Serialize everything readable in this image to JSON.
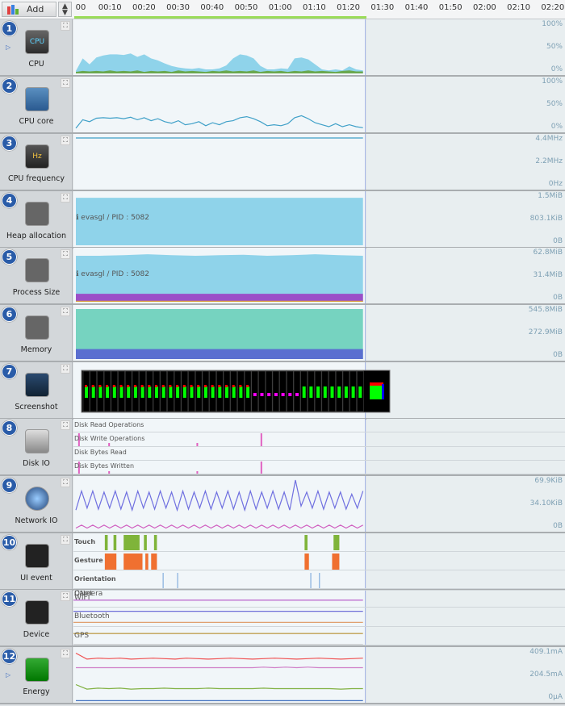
{
  "toolbar": {
    "add_label": "Add",
    "sort_icon": "up-down-arrows-icon",
    "add_icon": "bar-chart-icon"
  },
  "timeline": {
    "ticks": [
      "00",
      "00:10",
      "00:20",
      "00:30",
      "00:40",
      "00:50",
      "01:00",
      "01:10",
      "01:20",
      "01:30",
      "01:40",
      "01:50",
      "02:00",
      "02:10",
      "02:20"
    ],
    "recorded_seconds": 85
  },
  "rows": [
    {
      "num": "1",
      "label": "CPU",
      "icon": "cpu-chip-icon",
      "icon_text": "CPU",
      "axis": [
        "100%",
        "50%",
        "0%"
      ]
    },
    {
      "num": "2",
      "label": "CPU core",
      "icon": "cpu-core-icon",
      "axis": [
        "100%",
        "50%",
        "0%"
      ]
    },
    {
      "num": "3",
      "label": "CPU frequency",
      "icon": "hz-icon",
      "icon_text": "Hz",
      "axis": [
        "4.4MHz",
        "2.2MHz",
        "0Hz"
      ]
    },
    {
      "num": "4",
      "label": "Heap allocation",
      "icon": "memory-chip-icon",
      "axis": [
        "1.5MiB",
        "803.1KiB",
        "0B"
      ],
      "pid": "evasgl / PID : 5082"
    },
    {
      "num": "5",
      "label": "Process Size",
      "icon": "process-icon",
      "axis": [
        "62.8MiB",
        "31.4MiB",
        "0B"
      ],
      "pid": "evasgl / PID : 5082"
    },
    {
      "num": "6",
      "label": "Memory",
      "icon": "memory-icon",
      "axis": [
        "545.8MiB",
        "272.9MiB",
        "0B"
      ]
    },
    {
      "num": "7",
      "label": "Screenshot",
      "icon": "camera-icon"
    },
    {
      "num": "8",
      "label": "Disk IO",
      "icon": "hard-disk-icon",
      "subs": [
        "Disk Read Operations",
        "Disk Write Operations",
        "Disk Bytes Read",
        "Disk Bytes Written"
      ]
    },
    {
      "num": "9",
      "label": "Network IO",
      "icon": "network-icon",
      "axis": [
        "69.9KiB",
        "34.10KiB",
        "0B"
      ]
    },
    {
      "num": "10",
      "label": "UI event",
      "icon": "touch-phone-icon",
      "subs": [
        "Touch",
        "Gesture",
        "Orientation"
      ]
    },
    {
      "num": "11",
      "label": "Device",
      "icon": "device-icon",
      "subs": [
        "WIFI",
        "Bluetooth",
        "GPS",
        "DNet",
        "Camera"
      ]
    },
    {
      "num": "12",
      "label": "Energy",
      "icon": "battery-icon",
      "axis": [
        "409.1mA",
        "204.5mA",
        "0µA"
      ]
    }
  ],
  "series": {
    "cpu_total": [
      5,
      30,
      18,
      32,
      36,
      38,
      38,
      37,
      40,
      33,
      38,
      30,
      26,
      20,
      15,
      12,
      10,
      9,
      11,
      8,
      8,
      10,
      16,
      30,
      38,
      36,
      30,
      15,
      8,
      8,
      10,
      9,
      30,
      32,
      28,
      18,
      8,
      6,
      8,
      6,
      14,
      8,
      6
    ],
    "cpu_app": [
      3,
      5,
      4,
      5,
      4,
      6,
      4,
      5,
      4,
      6,
      3,
      5,
      4,
      5,
      3,
      6,
      4,
      5,
      4,
      3,
      5,
      4,
      6,
      4,
      5,
      4,
      6,
      3,
      5,
      4,
      5,
      3,
      5,
      4,
      6,
      4,
      5,
      4,
      3,
      5,
      6,
      4,
      4
    ],
    "cpu_core": [
      5,
      22,
      18,
      25,
      26,
      25,
      26,
      24,
      27,
      22,
      26,
      20,
      24,
      18,
      15,
      20,
      12,
      14,
      18,
      10,
      16,
      12,
      18,
      20,
      26,
      28,
      24,
      18,
      10,
      12,
      10,
      14,
      26,
      30,
      24,
      16,
      12,
      8,
      14,
      8,
      12,
      8,
      6
    ],
    "cpu_freq": [
      100
    ],
    "heap": [
      95
    ],
    "process": {
      "total": [
        92,
        92,
        93,
        95,
        93,
        92,
        93,
        94,
        92,
        93,
        95,
        93,
        92
      ],
      "rss": [
        16
      ],
      "shared": [
        2
      ]
    },
    "memory": {
      "total": [
        100
      ],
      "used": [
        20
      ]
    },
    "disk_write_ops": [
      [
        2,
        100
      ],
      [
        28,
        25
      ],
      [
        64,
        25
      ],
      [
        98,
        100
      ]
    ],
    "disk_bytes_written": [
      [
        2,
        100
      ],
      [
        28,
        25
      ],
      [
        64,
        25
      ],
      [
        98,
        100
      ]
    ],
    "network_rx": [
      40,
      78,
      44,
      78,
      42,
      76,
      44,
      78,
      42,
      76,
      40,
      78,
      44,
      76,
      42,
      78,
      44,
      76,
      40,
      78,
      42,
      76,
      44,
      78,
      42,
      76,
      44,
      78,
      42,
      76,
      40,
      78,
      42,
      76,
      44,
      78,
      42,
      76,
      40,
      100,
      48,
      76,
      44,
      78,
      42,
      76,
      44,
      76,
      42,
      72,
      44,
      78
    ],
    "network_tx": [
      4,
      10,
      4,
      10,
      4,
      10,
      4,
      10,
      4,
      10,
      4,
      10,
      4,
      10,
      4,
      10,
      4,
      10,
      4,
      10,
      4,
      10,
      4,
      10,
      4,
      10,
      4,
      10,
      4,
      10,
      4,
      10,
      4,
      10,
      4,
      10,
      4,
      10,
      4,
      10,
      4,
      10,
      4,
      10,
      4,
      10,
      4,
      10,
      4,
      10,
      4,
      10
    ],
    "touch_ms": [
      [
        10,
        11
      ],
      [
        13,
        14
      ],
      [
        16.5,
        22
      ],
      [
        23.5,
        24.5
      ],
      [
        27,
        28
      ],
      [
        79,
        80
      ],
      [
        89,
        91
      ]
    ],
    "gesture_ms": [
      [
        10,
        14
      ],
      [
        16.5,
        23
      ],
      [
        24,
        25
      ],
      [
        26,
        28
      ],
      [
        79,
        80.5
      ],
      [
        88.5,
        91
      ]
    ],
    "orientation_ms": [
      [
        30
      ],
      [
        35
      ],
      [
        81
      ],
      [
        84
      ]
    ],
    "energy": {
      "red": [
        96,
        84,
        86,
        85,
        86,
        84,
        85,
        86,
        85,
        84,
        86,
        85,
        84,
        85,
        86,
        85,
        84,
        85,
        86,
        85,
        84,
        85,
        86,
        85,
        84,
        85,
        86
      ],
      "pink": [
        67,
        67,
        67,
        67,
        67,
        67,
        67,
        67,
        67,
        67,
        67,
        67,
        67,
        67,
        67,
        67,
        67,
        68,
        67,
        68,
        67,
        68,
        67,
        67,
        67,
        67,
        67
      ],
      "green": [
        33,
        24,
        26,
        25,
        26,
        24,
        25,
        25,
        26,
        25,
        25,
        25,
        26,
        25,
        25,
        25,
        25,
        26,
        25,
        25,
        25,
        25,
        25,
        25,
        24,
        25,
        25
      ],
      "blue": [
        1
      ]
    }
  },
  "colors": {
    "cpu_fill": "#8fd3ea",
    "cpu_app": "#6aa84f",
    "line_blue": "#3fa0c8",
    "heap": "#8fd3ea",
    "process_rss": "#9b4fc8",
    "process_shared": "#d9a040",
    "memory_total": "#76d3c0",
    "memory_used": "#5a6fd0",
    "disk": "#e060c0",
    "net_rx": "#7070e0",
    "net_tx": "#d060c0",
    "touch": "#7fb43a",
    "gesture": "#f07030",
    "orientation": "#6fa0d8",
    "wifi": "#c070d0",
    "bluetooth": "#7070d8",
    "gps": "#e0a070",
    "dnet": "#c0a050",
    "camera": "#c0c0c0",
    "energy_red": "#f05050",
    "energy_pink": "#d080c8",
    "energy_green": "#80b040",
    "energy_blue": "#4070c0"
  }
}
